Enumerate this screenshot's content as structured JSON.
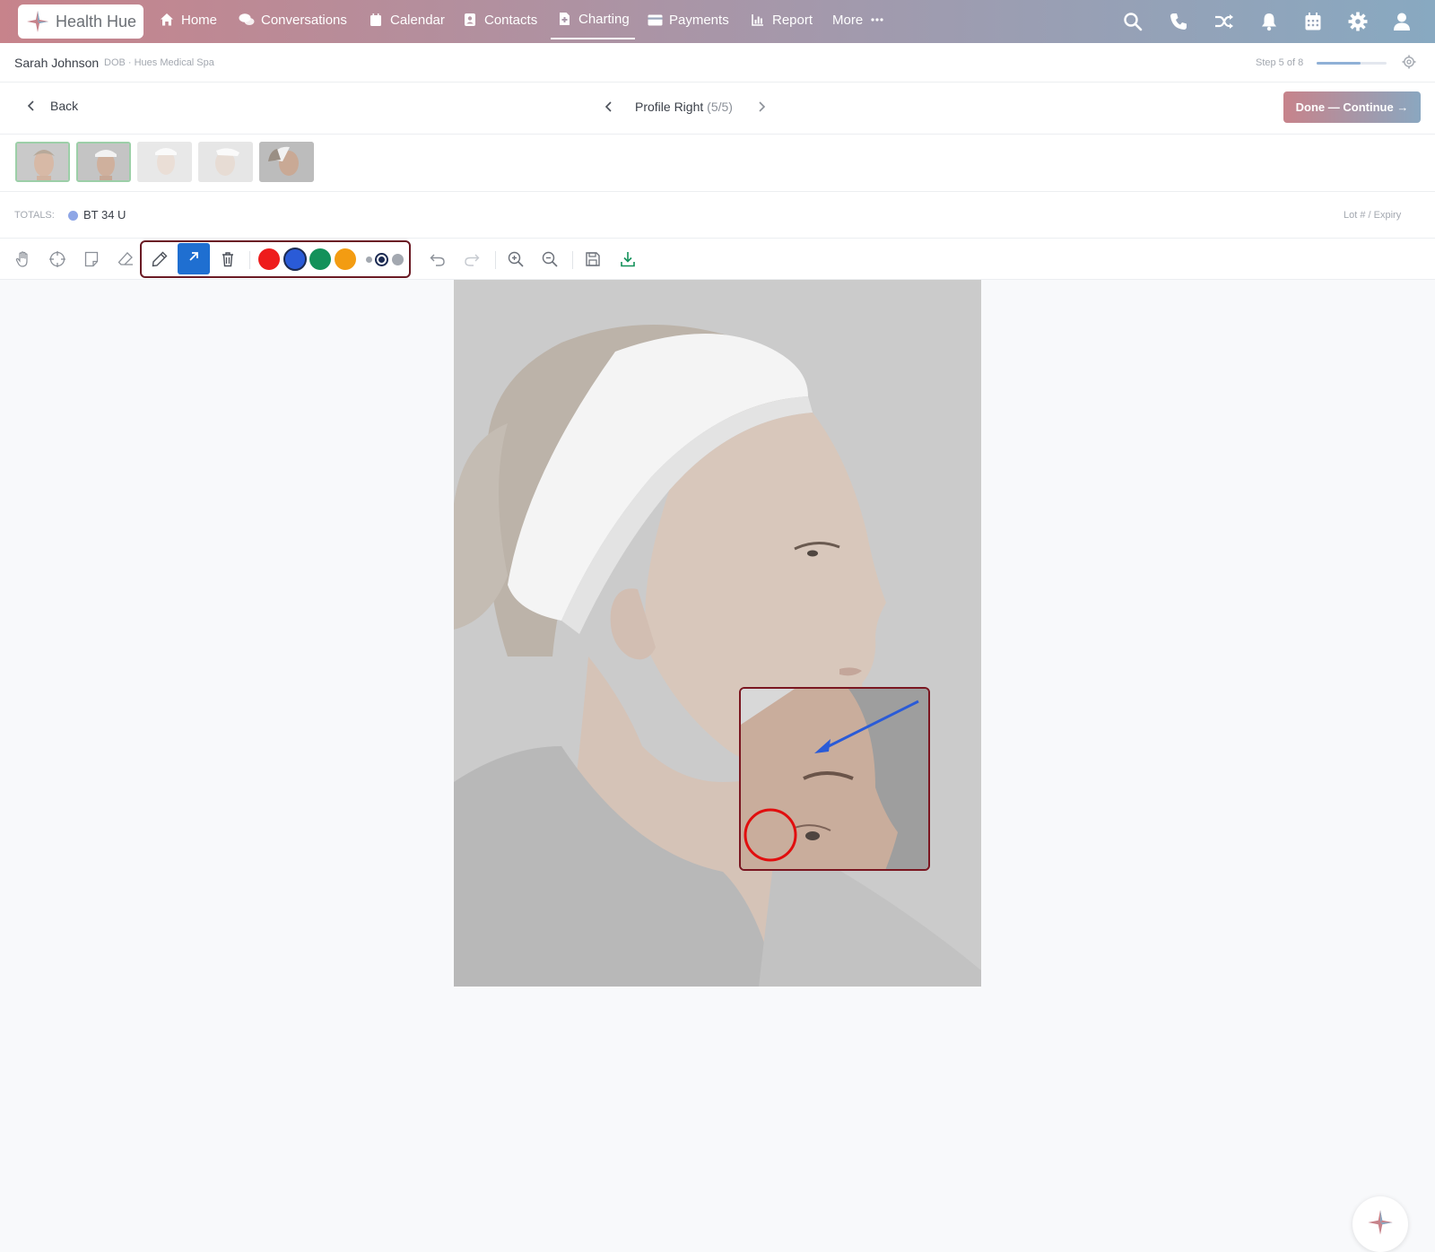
{
  "app": {
    "name": "Health Hue"
  },
  "nav": {
    "items": [
      {
        "label": "Home",
        "icon": "home-icon"
      },
      {
        "label": "Conversations",
        "icon": "chat-icon"
      },
      {
        "label": "Calendar",
        "icon": "calendar-icon"
      },
      {
        "label": "Contacts",
        "icon": "contacts-icon"
      },
      {
        "label": "Charting",
        "icon": "charting-icon",
        "active": true
      },
      {
        "label": "Payments",
        "icon": "payments-icon"
      },
      {
        "label": "Report",
        "icon": "report-icon"
      },
      {
        "label": "More",
        "icon": "more-dots-icon"
      }
    ],
    "right_icons": [
      "search-icon",
      "phone-icon",
      "shuffle-icon",
      "bell-icon",
      "calendar-icon",
      "gear-icon",
      "user-icon"
    ]
  },
  "patient": {
    "name": "Sarah Johnson",
    "meta": "DOB · Hues Medical Spa",
    "step_text": "Step 5 of 8",
    "step_progress": 0.625
  },
  "header": {
    "back_label": "Back",
    "view_title": "Profile Right",
    "view_count": "(5/5)",
    "done_label": "Done — Continue →"
  },
  "totals": {
    "label": "TOTALS:",
    "value": "BT 34 U",
    "lot_label": "Lot # / Expiry"
  },
  "toolbar": {
    "colors": [
      "#ee1c1c",
      "#2a5bd7",
      "#13915a",
      "#f39c12"
    ],
    "selected_color": "#2a5bd7",
    "active_tool": "arrow"
  }
}
